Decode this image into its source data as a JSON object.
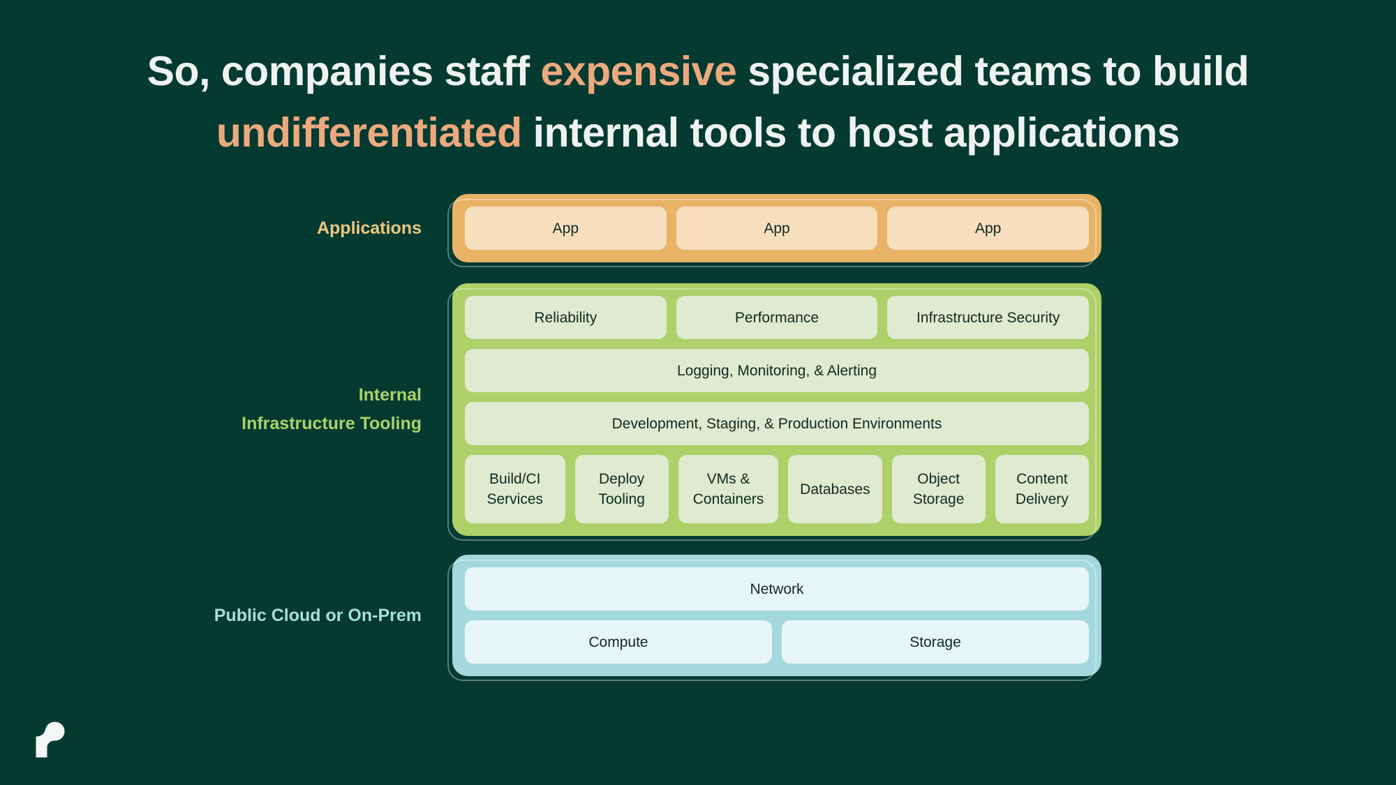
{
  "slide": {
    "background_color": "#053a31",
    "accent_color": "#eca97e",
    "title": {
      "line1_part1": "So, companies staff ",
      "line1_accent": "expensive",
      "line1_part2": " specialized teams to build",
      "line2_accent": "undifferentiated",
      "line2_part2": " internal tools to host applications"
    },
    "logo_name": "render-logo"
  },
  "tiers": [
    {
      "key": "applications",
      "label": "Applications",
      "label_color": "#ecc87e",
      "panel_color": "#e8b366",
      "card_color": "#f7dfbd",
      "rows": [
        {
          "cards": [
            "App",
            "App",
            "App"
          ]
        }
      ]
    },
    {
      "key": "internal_infrastructure_tooling",
      "label": "Internal\nInfrastructure Tooling",
      "label_color": "#a9d36a",
      "panel_color": "#aed069",
      "card_color": "#e0ead0",
      "rows": [
        {
          "cards": [
            "Reliability",
            "Performance",
            "Infrastructure Security"
          ]
        },
        {
          "cards": [
            "Logging, Monitoring, & Alerting"
          ]
        },
        {
          "cards": [
            "Development, Staging, & Production Environments"
          ]
        },
        {
          "cards": [
            "Build/CI\nServices",
            "Deploy\nTooling",
            "VMs &\nContainers",
            "Databases",
            "Object\nStorage",
            "Content\nDelivery"
          ]
        }
      ]
    },
    {
      "key": "public_cloud_or_on_prem",
      "label": "Public Cloud or On-Prem",
      "label_color": "#a6dfdc",
      "panel_color": "#a3d8de",
      "card_color": "#e8f5f6",
      "rows": [
        {
          "cards": [
            "Network"
          ]
        },
        {
          "cards": [
            "Compute",
            "Storage"
          ]
        }
      ]
    }
  ]
}
